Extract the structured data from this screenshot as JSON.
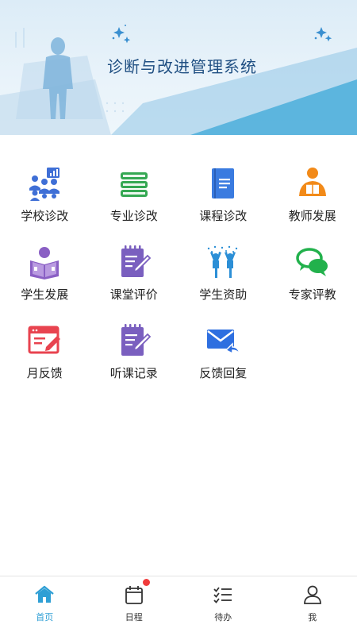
{
  "banner": {
    "title": "诊断与改进管理系统"
  },
  "menu": {
    "rows": [
      [
        {
          "label": "学校诊改",
          "icon": "people-chart-icon",
          "color": "#3f6fd6"
        },
        {
          "label": "专业诊改",
          "icon": "books-stack-icon",
          "color": "#35a853"
        },
        {
          "label": "课程诊改",
          "icon": "book-icon",
          "color": "#3a7be0"
        },
        {
          "label": "教师发展",
          "icon": "teacher-icon",
          "color": "#f28a19"
        }
      ],
      [
        {
          "label": "学生发展",
          "icon": "student-reading-icon",
          "color": "#8a5fc4"
        },
        {
          "label": "课堂评价",
          "icon": "notepad-pen-icon",
          "color": "#7a5fbf"
        },
        {
          "label": "学生资助",
          "icon": "cheering-students-icon",
          "color": "#2c8fd6"
        },
        {
          "label": "专家评教",
          "icon": "chat-bubbles-icon",
          "color": "#22b14c"
        }
      ],
      [
        {
          "label": "月反馈",
          "icon": "browser-edit-icon",
          "color": "#e8434f"
        },
        {
          "label": "听课记录",
          "icon": "notepad-pen-icon",
          "color": "#7a5fbf"
        },
        {
          "label": "反馈回复",
          "icon": "envelope-reply-icon",
          "color": "#2e6fe0"
        }
      ]
    ]
  },
  "tabbar": {
    "items": [
      {
        "label": "首页",
        "icon": "home-icon",
        "active": true
      },
      {
        "label": "日程",
        "icon": "calendar-icon",
        "badge": true
      },
      {
        "label": "待办",
        "icon": "checklist-icon"
      },
      {
        "label": "我",
        "icon": "user-icon"
      }
    ],
    "active_color": "#2f9fd5",
    "badge_color": "#f03c3c"
  }
}
